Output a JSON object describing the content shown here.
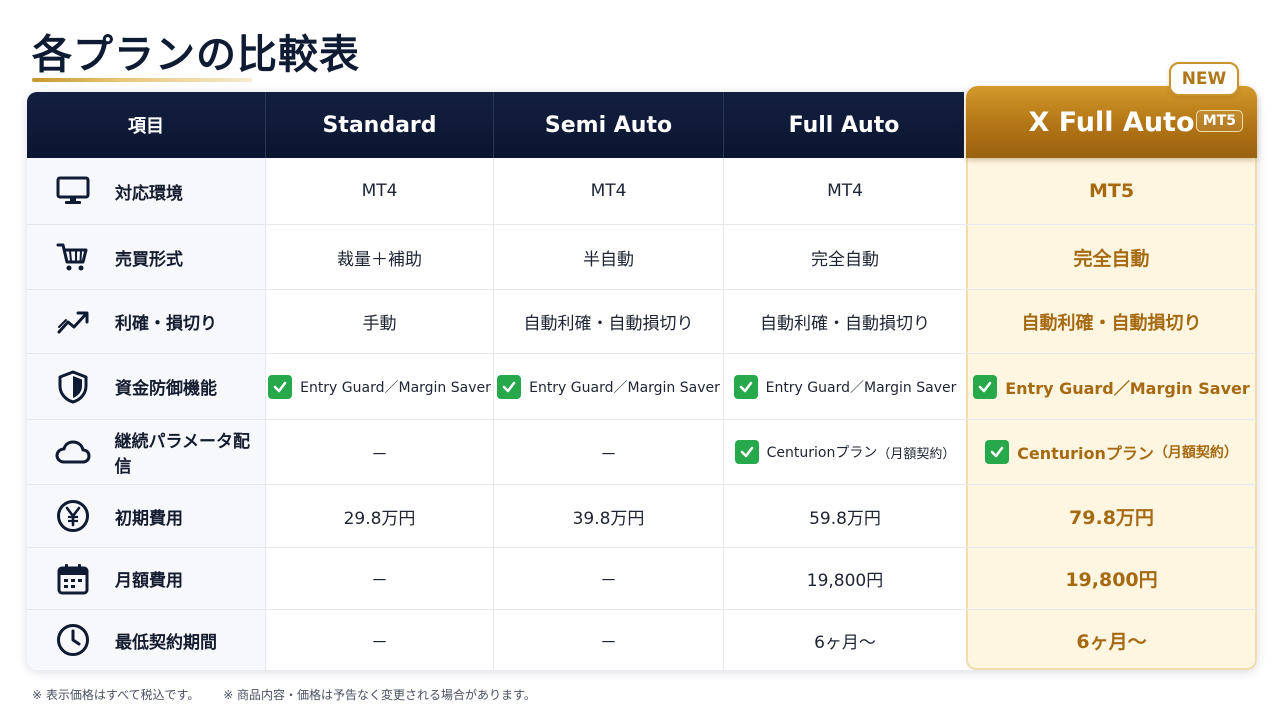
{
  "title": "各プランの比較表",
  "badge_new": "NEW",
  "header": {
    "item": "項目",
    "standard": "Standard",
    "semi": "Semi Auto",
    "full": "Full Auto",
    "xfull": "X Full Auto",
    "xfull_badge": "MT5"
  },
  "rows": [
    {
      "label": "対応環境",
      "icon": "monitor-icon",
      "c1": "MT4",
      "c2": "MT4",
      "c3": "MT4",
      "cx": "MT5"
    },
    {
      "label": "売買形式",
      "icon": "cart-icon",
      "c1": "裁量＋補助",
      "c2": "半自動",
      "c3": "完全自動",
      "cx": "完全自動"
    },
    {
      "label": "利確・損切り",
      "icon": "trend-up-icon",
      "c1": "手動",
      "c2": "自動利確・自動損切り",
      "c3": "自動利確・自動損切り",
      "cx": "自動利確・自動損切り"
    },
    {
      "label": "資金防御機能",
      "icon": "shield-icon",
      "c1": "Entry Guard／Margin Saver",
      "c2": "Entry Guard／Margin Saver",
      "c3": "Entry Guard／Margin Saver",
      "cx": "Entry Guard／Margin Saver"
    },
    {
      "label": "継続パラメータ配信",
      "icon": "cloud-icon",
      "c1": "－",
      "c2": "－",
      "c3": "Centurionプラン",
      "c3_paren": "（月額契約）",
      "cx": "Centurionプラン",
      "cx_paren": "（月額契約）"
    },
    {
      "label": "初期費用",
      "icon": "yen-icon",
      "c1": "29.8万円",
      "c2": "39.8万円",
      "c3": "59.8万円",
      "cx": "79.8万円"
    },
    {
      "label": "月額費用",
      "icon": "calendar-icon",
      "c1": "－",
      "c2": "－",
      "c3": "19,800円",
      "cx": "19,800円"
    },
    {
      "label": "最低契約期間",
      "icon": "clock-icon",
      "c1": "－",
      "c2": "－",
      "c3": "6ヶ月～",
      "cx": "6ヶ月～"
    }
  ],
  "footnotes": [
    "※ 表示価格はすべて税込です。",
    "※ 商品内容・価格は予告なく変更される場合があります。"
  ],
  "colors": {
    "navy": "#0b1530",
    "gold": "#b27415",
    "gold_text": "#a56a12",
    "check_green": "#27a84a"
  }
}
